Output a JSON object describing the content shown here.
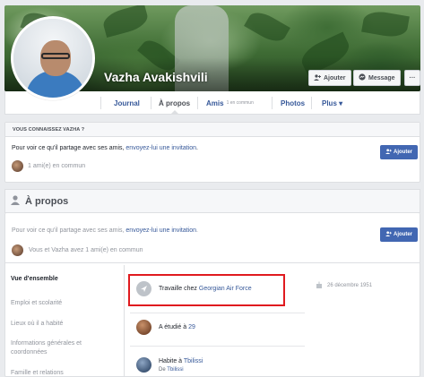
{
  "profile": {
    "name": "Vazha Avakishvili"
  },
  "cover_buttons": {
    "add_label": "Ajouter",
    "message_label": "Message",
    "more_label": "···"
  },
  "tabs": {
    "journal": "Journal",
    "about": "À propos",
    "friends": "Amis",
    "friends_sub": "1 en commun",
    "photos": "Photos",
    "more": "Plus ▾"
  },
  "know_card": {
    "header": "VOUS CONNAISSEZ VAZHA ?",
    "text": "Pour voir ce qu'il partage avec ses amis, ",
    "link": "envoyez-lui une invitation",
    "text_end": ".",
    "mutual": "1 ami(e) en commun",
    "add_label": "Ajouter"
  },
  "about_section": {
    "title": "À propos",
    "text": "Pour voir ce qu'il partage avec ses amis, ",
    "link": "envoyez-lui une invitation",
    "text_end": ".",
    "mutual": "Vous et Vazha avez 1 ami(e) en commun",
    "add_label": "Ajouter"
  },
  "sidebar": {
    "items": [
      "Vue d'ensemble",
      "Emploi et scolarité",
      "Lieux où il a habité",
      "Informations générales et coordonnées",
      "Famille et relations"
    ]
  },
  "overview": {
    "work_prefix": "Travaille chez ",
    "work_link": "Georgian Air Force",
    "study_prefix": "A étudié à ",
    "study_link": "29",
    "lives_prefix": "Habite à ",
    "lives_link": "Tbilissi",
    "from_prefix": "De ",
    "from_link": "Tbilissi",
    "birthday": "26 décembre 1951"
  },
  "colors": {
    "brand_blue": "#4267b2",
    "link": "#365899",
    "highlight": "#e01a1f"
  }
}
